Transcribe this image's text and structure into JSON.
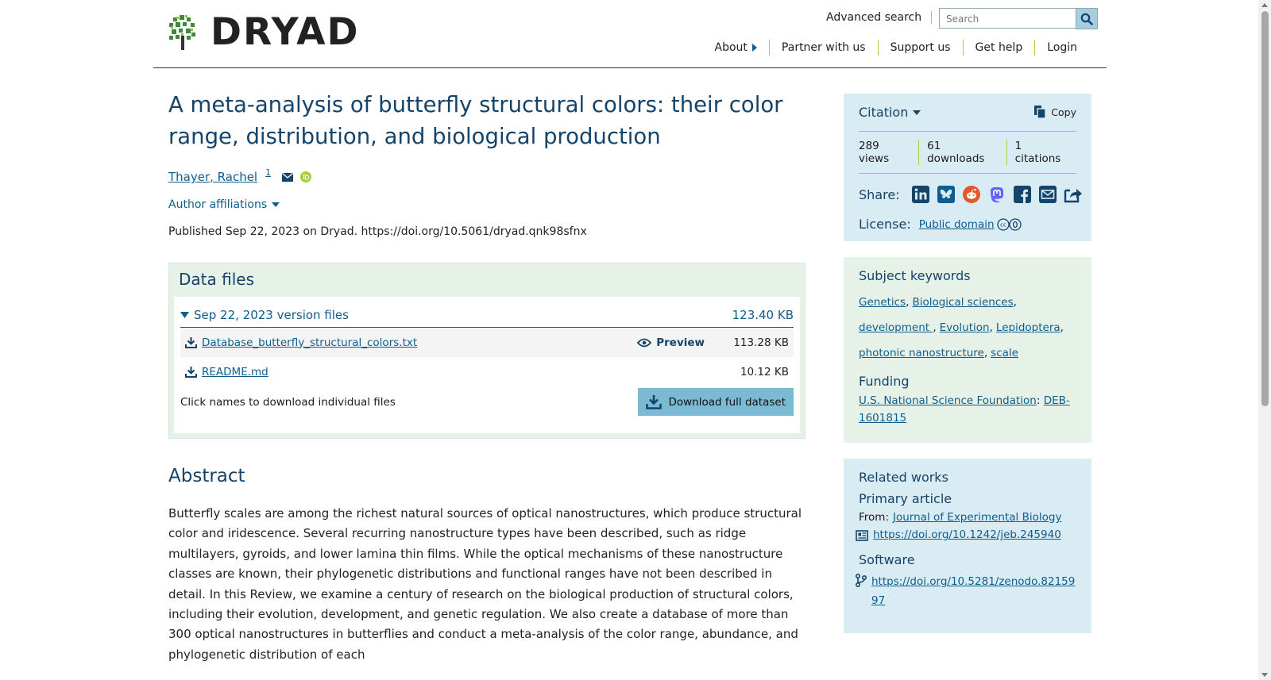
{
  "header": {
    "logo_text": "DRYAD",
    "advanced_search": "Advanced search",
    "search_placeholder": "Search",
    "nav": [
      "About",
      "Partner with us",
      "Support us",
      "Get help",
      "Login"
    ]
  },
  "dataset": {
    "title": "A meta-analysis of butterfly structural colors: their color range, distribution, and biological production",
    "author": "Thayer, Rachel",
    "author_affil_num": "1",
    "affiliations_label": "Author affiliations",
    "published": "Published Sep 22, 2023 on Dryad. https://doi.org/10.5061/dryad.qnk98sfnx"
  },
  "data_files": {
    "title": "Data files",
    "version_label": "Sep 22, 2023 version files",
    "version_size": "123.40 KB",
    "files": [
      {
        "name": "Database_butterfly_structural_colors.txt",
        "size": "113.28 KB",
        "preview": "Preview"
      },
      {
        "name": "README.md",
        "size": "10.12 KB"
      }
    ],
    "hint": "Click names to download individual files",
    "download_label": "Download full dataset"
  },
  "abstract": {
    "title": "Abstract",
    "text": "Butterfly scales are among the richest natural sources of optical nanostructures, which produce structural color and iridescence. Several recurring nanostructure types have been described, such as ridge multilayers, gyroids, and lower lamina thin films. While the optical mechanisms of these nanostructure classes are known, their phylogenetic distributions and functional ranges have not been described in detail. In this Review, we examine a century of research on the biological production of structural colors, including their evolution, development, and genetic regulation. We also create a database of more than 300 optical nanostructures in butterflies and conduct a meta-analysis of the color range, abundance, and phylogenetic distribution of each"
  },
  "citation": {
    "title": "Citation",
    "copy": "Copy",
    "views": "289 views",
    "downloads": "61 downloads",
    "citations": "1 citations",
    "share_label": "Share:",
    "license_label": "License:",
    "license_value": "Public domain"
  },
  "keywords": {
    "title": "Subject keywords",
    "items": [
      "Genetics",
      "Biological sciences",
      "development ",
      "Evolution",
      "Lepidoptera",
      "photonic nanostructure",
      "scale"
    ],
    "funding_title": "Funding",
    "funder": "U.S. National Science Foundation",
    "grant": "DEB-1601815"
  },
  "related": {
    "title": "Related works",
    "primary_title": "Primary article",
    "from_label": "From:",
    "journal": "Journal of Experimental Biology",
    "primary_doi": "https://doi.org/10.1242/jeb.245940",
    "software_title": "Software",
    "software_doi": "https://doi.org/10.5281/zenodo.8215997"
  },
  "colors": {
    "title_blue": "#15446a",
    "link_blue": "#0d5e8e",
    "citation_bg": "#d9ebf3",
    "keywords_bg": "#e6f1e8",
    "accent_green": "#b7c93c"
  }
}
